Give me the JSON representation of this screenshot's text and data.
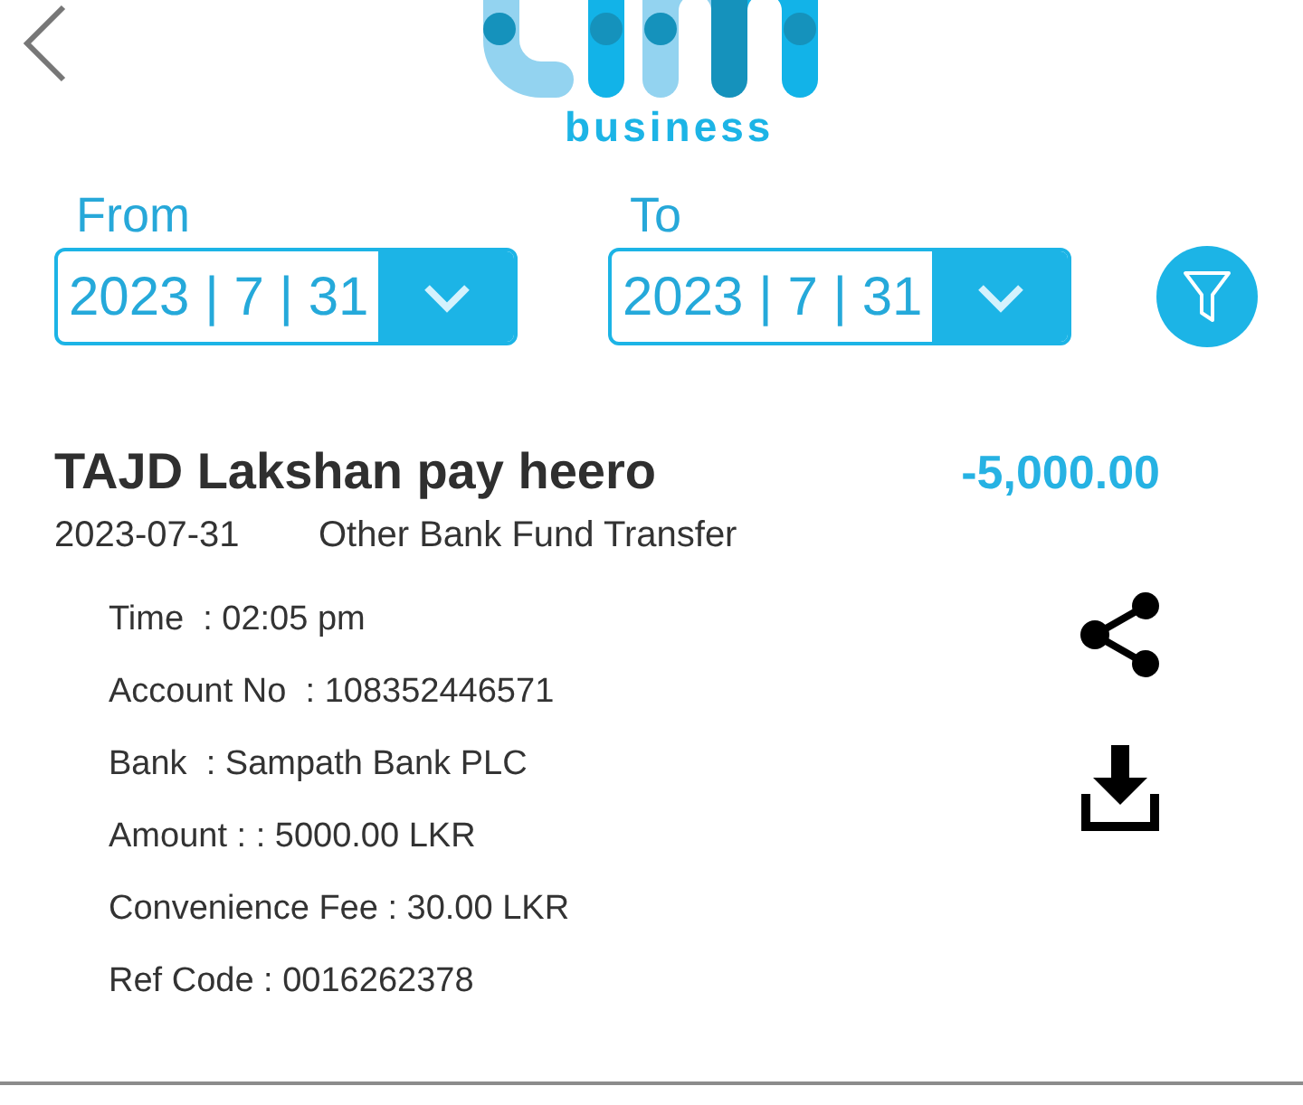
{
  "header": {
    "logo_subtitle": "business"
  },
  "date_range": [
    {
      "label": "From",
      "value": "2023 | 7 | 31"
    },
    {
      "label": "To",
      "value": "2023 | 7 | 31"
    }
  ],
  "transaction": {
    "title": "TAJD Lakshan pay heero",
    "amount": "-5,000.00",
    "date": "2023-07-31",
    "type": "Other Bank Fund Transfer",
    "details": [
      "Time  : 02:05 pm",
      "Account No  : 108352446571",
      "Bank  : Sampath Bank PLC",
      "Amount : : 5000.00 LKR",
      "Convenience Fee : 30.00 LKR",
      "Ref Code : 0016262378"
    ]
  }
}
